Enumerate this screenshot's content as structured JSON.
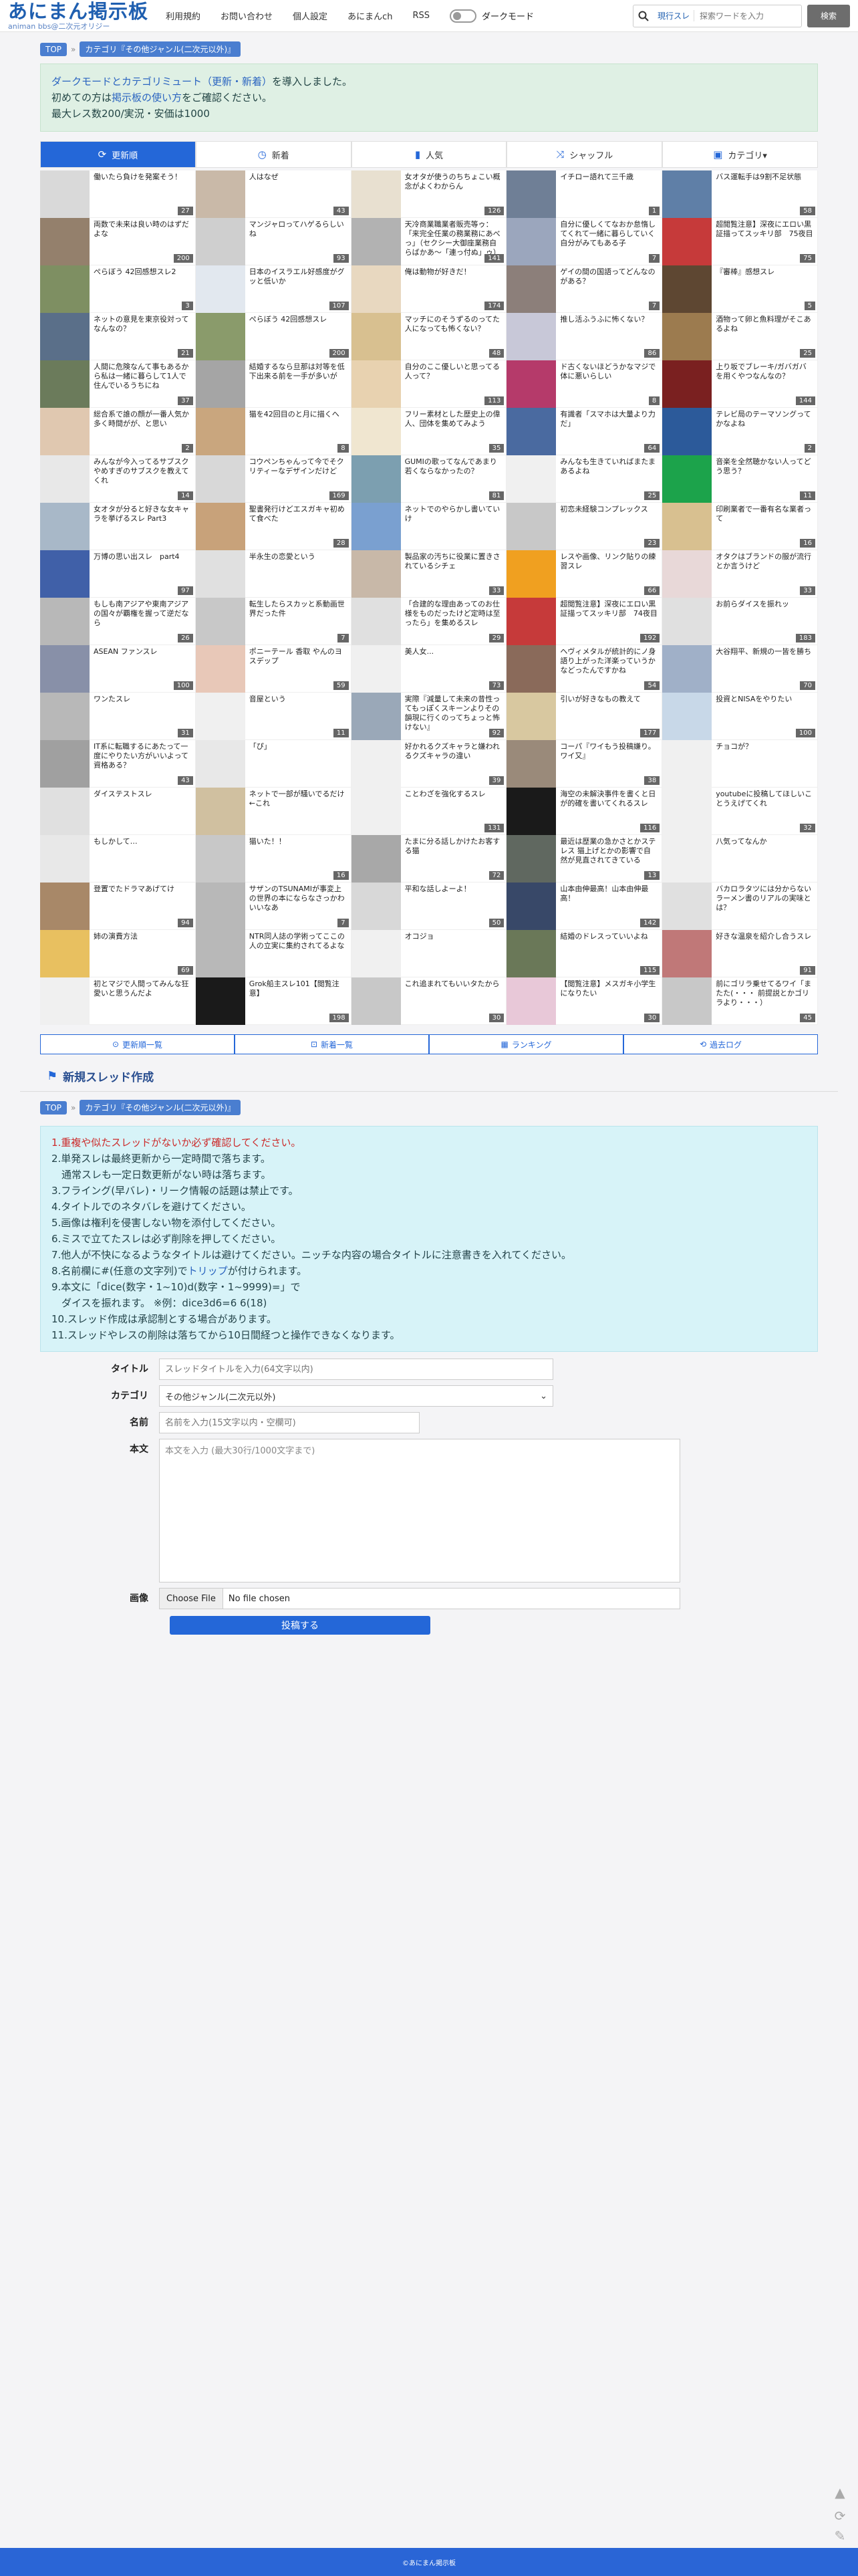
{
  "header": {
    "logo_main": "あにまん掲示板",
    "logo_sub": "animan bbs@二次元オリジー",
    "nav": [
      "利用規約",
      "お問い合わせ",
      "個人設定",
      "あにまんch",
      "RSS"
    ],
    "dark_mode": "ダークモード",
    "search_scope": "現行スレ",
    "search_placeholder": "探索ワードを入力",
    "search_button": "検索"
  },
  "breadcrumb": {
    "top": "TOP",
    "category": "カテゴリ『その他ジャンル(二次元以外)』"
  },
  "notice": {
    "line1_hl": "ダークモードとカテゴリミュート（更新・新着）",
    "line1_rest": "を導入しました。",
    "line2_pre": "初めての方は",
    "line2_hl": "掲示板の使い方",
    "line2_rest": "をご確認ください。",
    "line3": "最大レス数200/実況・安価は1000"
  },
  "tabs": [
    {
      "label": "更新順",
      "icon": "refresh-icon",
      "sym": "⟳",
      "active": true
    },
    {
      "label": "新着",
      "icon": "clock-icon",
      "sym": "◷",
      "active": false
    },
    {
      "label": "人気",
      "icon": "bar-chart-icon",
      "sym": "▮",
      "active": false
    },
    {
      "label": "シャッフル",
      "icon": "shuffle-icon",
      "sym": "⤨",
      "active": false
    },
    {
      "label": "カテゴリ▾",
      "icon": "folder-icon",
      "sym": "▣",
      "active": false
    }
  ],
  "threads": [
    {
      "t": "働いたら負けを発案そう！",
      "c": "27",
      "bg": "#d9d9d9"
    },
    {
      "t": "人はなぜ",
      "c": "43",
      "bg": "#c9b9a8"
    },
    {
      "t": "女オタが使うのちちょこい概念がよくわからん",
      "c": "126",
      "bg": "#e8e0d0"
    },
    {
      "t": "イチロー語れて三千歳",
      "c": "1",
      "bg": "#6f7f96"
    },
    {
      "t": "バス運転手は9割不足状態",
      "c": "58",
      "bg": "#5f7fa7"
    },
    {
      "t": "両数で未来は良い時のはずだよな",
      "c": "200",
      "bg": "#94806c"
    },
    {
      "t": "マンジャロってハゲるらしいね",
      "c": "93",
      "bg": "#cfcfcf"
    },
    {
      "t": "天冷商業職業者販売等ゥ：「来完全任業の務業務にあべっ」（セクシー大御座業務自らばかあ〜「連っ付ぬ」ゥ）",
      "c": "141",
      "bg": "#b2b2b2"
    },
    {
      "t": "自分に優しくてなおか怠惰してくれて一緒に暮らしていく自分がみてもある子",
      "c": "7",
      "bg": "#9ba6bd"
    },
    {
      "t": "超閲覧注意】深夜にエロい黒証描ってスッキリ部　75夜目",
      "c": "75",
      "bg": "#c63a3a"
    },
    {
      "t": "ぺらぼう 42回感想スレ2",
      "c": "3",
      "bg": "#7e8f62"
    },
    {
      "t": "日本のイスラエル好感度がグッと低いか",
      "c": "107",
      "bg": "#e2e8ef"
    },
    {
      "t": "俺は動物が好きだ！",
      "c": "174",
      "bg": "#e8d8c0"
    },
    {
      "t": "ゲイの間の国語ってどんなのがある？",
      "c": "7",
      "bg": "#8c7f7a"
    },
    {
      "t": "『審棒』感想スレ",
      "c": "5",
      "bg": "#5e4732"
    },
    {
      "t": "ネットの意見を東京役対ってなんなの？",
      "c": "21",
      "bg": "#5a6f89"
    },
    {
      "t": "ぺらぼう 42回感想スレ",
      "c": "200",
      "bg": "#8a9b6b"
    },
    {
      "t": "マッチにのそうずるのってた人になっても怖くない？",
      "c": "48",
      "bg": "#d8c090"
    },
    {
      "t": "推し活ふうふに怖くない？",
      "c": "86",
      "bg": "#c8c8d8"
    },
    {
      "t": "酒物って卵と魚料理がそこあるよね",
      "c": "25",
      "bg": "#9c7b4f"
    },
    {
      "t": "人間に危険なんて事もあるから私は一緒に暮らして1人で住んでいるうちにね",
      "c": "37",
      "bg": "#6b7b5b"
    },
    {
      "t": "結婚するなら旦那は対等を低下出来る前を一手が多いが",
      "c": "",
      "bg": "#a5a5a5"
    },
    {
      "t": "自分のここ優しいと思ってる人って？",
      "c": "113",
      "bg": "#e8d2b0"
    },
    {
      "t": "ド古くないほどうかなマジで体に悪いらしい",
      "c": "8",
      "bg": "#b53a6a"
    },
    {
      "t": "上り坂でブレーキ/ガバガバを用くやつなんなの？",
      "c": "144",
      "bg": "#7a2020"
    },
    {
      "t": "総合系で誰の顔が一番人気か多く時間がが、と思い",
      "c": "2",
      "bg": "#e0c8b0"
    },
    {
      "t": "猫を42回目のと月に描くへ",
      "c": "8",
      "bg": "#c9a67e"
    },
    {
      "t": "フリー素材とした歴史上の偉人、団体を集めてみよう",
      "c": "35",
      "bg": "#f0e6d0"
    },
    {
      "t": "有識者「スマホは大量より力だ」",
      "c": "64",
      "bg": "#4a6aa0"
    },
    {
      "t": "テレビ局のテーマソングってかなよね",
      "c": "2",
      "bg": "#2c5a9a"
    },
    {
      "t": "みんなが今入ってるサブスク やめすぎのサブスクを教えてくれ",
      "c": "14",
      "bg": "#e8e8e8"
    },
    {
      "t": "コウペンちゃんって今でそクリティーなデザインだけど",
      "c": "169",
      "bg": "#d8d8d8"
    },
    {
      "t": "GUMIの歌ってなんであまり若くならなかったの？",
      "c": "81",
      "bg": "#7c9fb0"
    },
    {
      "t": "みんなも生きていればまたまあるよね",
      "c": "25",
      "bg": "#f0f0f0"
    },
    {
      "t": "音楽を全然聴かない人ってどう思う？",
      "c": "11",
      "bg": "#1ca34b"
    },
    {
      "t": "女オタが分ると好きな女キャラを挙げるスレ Part3",
      "c": "",
      "bg": "#a8b8c8"
    },
    {
      "t": "聖書発行けどエスガキャ初めて食べた",
      "c": "28",
      "bg": "#c8a27a"
    },
    {
      "t": "ネットでのやらかし書いていけ",
      "c": "",
      "bg": "#7aa0d0"
    },
    {
      "t": "初恋未経験コンプレックス",
      "c": "23",
      "bg": "#c8c8c8"
    },
    {
      "t": "印刷業者で一番有名な業者って",
      "c": "16",
      "bg": "#d8c090"
    },
    {
      "t": "万博の思い出スレ　part4",
      "c": "97",
      "bg": "#4060a8"
    },
    {
      "t": "半永生の恋愛という",
      "c": "",
      "bg": "#e0e0e0"
    },
    {
      "t": "製品家の汚ちに役業に置きされているシチェ",
      "c": "33",
      "bg": "#c8b8a8"
    },
    {
      "t": "レスや画像、リンク貼りの練習スレ",
      "c": "66",
      "bg": "#f0a020"
    },
    {
      "t": "オタクはブランドの服が流行とか言うけど",
      "c": "33",
      "bg": "#e8d8d8"
    },
    {
      "t": "もしも南アジアや東南アジアの国々が覇権を握って逆だなら",
      "c": "26",
      "bg": "#b8b8b8"
    },
    {
      "t": "転生したらスカッと系動画世界だった件",
      "c": "7",
      "bg": "#c8c8c8"
    },
    {
      "t": "「合建的な理由あってのお仕様をものだったけど定時は至ったら」を集めるスレ",
      "c": "29",
      "bg": "#e0e0e0"
    },
    {
      "t": "超閲覧注意】深夜にエロい黒証描ってスッキリ部　74夜目",
      "c": "192",
      "bg": "#c63a3a"
    },
    {
      "t": "お前らダイスを振れッ",
      "c": "183",
      "bg": "#e0e0e0"
    },
    {
      "t": "ASEAN ファンスレ",
      "c": "100",
      "bg": "#8890a8"
    },
    {
      "t": "ポニーテール 香取 やんのヨスデップ",
      "c": "59",
      "bg": "#e8c8b8"
    },
    {
      "t": "美人女...",
      "c": "73",
      "bg": "#f0f0f0"
    },
    {
      "t": "ヘヴィメタルが統計的にノ身語り上がった洋楽っていうかなどったんですかね",
      "c": "54",
      "bg": "#8a6a5a"
    },
    {
      "t": "大谷翔平、新規の一皆を勝ち",
      "c": "70",
      "bg": "#a0b0c8"
    },
    {
      "t": "ワンたスレ",
      "c": "31",
      "bg": "#b8b8b8"
    },
    {
      "t": "音屋という",
      "c": "11",
      "bg": "#f0f0f0"
    },
    {
      "t": "実際『減量して未来の昔性ってもっぽくスキーンよりその韻現に行くのってちょっと怖けない』",
      "c": "92",
      "bg": "#9aa8b8"
    },
    {
      "t": "引いが好きなもの教えて",
      "c": "177",
      "bg": "#d8c8a0"
    },
    {
      "t": "投資とNISAをやりたい",
      "c": "100",
      "bg": "#c8d8e8"
    },
    {
      "t": "IT系に転職するにあたって一度にやりたい方がいいよって資格ある？",
      "c": "43",
      "bg": "#a0a0a0"
    },
    {
      "t": "「ぴ」",
      "c": "",
      "bg": "#e8e8e8"
    },
    {
      "t": "好かれるクズキャラと嫌われるクズキャラの違い",
      "c": "39",
      "bg": "#f0f0f0"
    },
    {
      "t": "コーパ『ワイもう投稿嫌り。ワイ又』",
      "c": "38",
      "bg": "#9a8a7a"
    },
    {
      "t": "チョコが？",
      "c": "",
      "bg": "#f0f0f0"
    },
    {
      "t": "ダイステストスレ",
      "c": "",
      "bg": "#e0e0e0"
    },
    {
      "t": "ネットで一部が騒いでるだけ←これ",
      "c": "",
      "bg": "#d0c0a0"
    },
    {
      "t": "ことわざを強化するスレ",
      "c": "131",
      "bg": "#f0f0f0"
    },
    {
      "t": "海空の未解決事件を書くと日が的確を書いてくれるスレ",
      "c": "116",
      "bg": "#1a1a1a"
    },
    {
      "t": "youtubeに投稿してほしいことうえげてくれ",
      "c": "32",
      "bg": "#f0f0f0"
    },
    {
      "t": "もしかして…",
      "c": "",
      "bg": "#e8e8e8"
    },
    {
      "t": "猫いた！！",
      "c": "16",
      "bg": "#c8c8c8"
    },
    {
      "t": "たまに分る話しかけたお客する猫",
      "c": "72",
      "bg": "#a8a8a8"
    },
    {
      "t": "最近は歴業の急かさとかステレス 猫上げとかの影響で自然が見直されてきている",
      "c": "13",
      "bg": "#606860"
    },
    {
      "t": "八気ってなんか",
      "c": "",
      "bg": "#f0f0f0"
    },
    {
      "t": "登置でたドラマあげてけ",
      "c": "94",
      "bg": "#a88868"
    },
    {
      "t": "サザンのTSUNAMIが事変上の世界の本にならなさっかわいいなあ",
      "c": "7",
      "bg": "#b8b8b8"
    },
    {
      "t": "平和な話しよーよ！",
      "c": "50",
      "bg": "#d8d8d8"
    },
    {
      "t": "山本由伸最高！山本由伸最高！",
      "c": "142",
      "bg": "#384868"
    },
    {
      "t": "バカロラタツには分からないラーメン書のリアルの実味とは？",
      "c": "",
      "bg": "#e0e0e0"
    },
    {
      "t": "姉の演費方法",
      "c": "69",
      "bg": "#e8c060"
    },
    {
      "t": "NTR同人誌の学術ってここの人の立実に集約されてるよな",
      "c": "",
      "bg": "#b8b8b8"
    },
    {
      "t": "オコジョ",
      "c": "",
      "bg": "#f0f0f0"
    },
    {
      "t": "結婚のドレスっていいよね",
      "c": "115",
      "bg": "#6a7858"
    },
    {
      "t": "好きな温泉を紹介し合うスレ",
      "c": "91",
      "bg": "#c07878"
    },
    {
      "t": "初とマジで人間ってみんな狂愛いと思うんだよ",
      "c": "",
      "bg": "#f0f0f0"
    },
    {
      "t": "Grok船主スレ101【閲覧注意】",
      "c": "198",
      "bg": "#1a1a1a"
    },
    {
      "t": "これ追まれてもいいタたから",
      "c": "30",
      "bg": "#c8c8c8"
    },
    {
      "t": "【閲覧注意】メスガキ小学生になりたい",
      "c": "30",
      "bg": "#e8c8d8"
    },
    {
      "t": "前にゴリラ乗せてるワイ「またた(・・・ 前提説とかゴリラより・・・）",
      "c": "45",
      "bg": "#c8c8c8"
    }
  ],
  "links": [
    {
      "label": "更新順一覧",
      "icon": "list-icon",
      "sym": "⊙"
    },
    {
      "label": "新着一覧",
      "icon": "new-icon",
      "sym": "⊡"
    },
    {
      "label": "ランキング",
      "icon": "ranking-icon",
      "sym": "▦"
    },
    {
      "label": "過去ログ",
      "icon": "history-icon",
      "sym": "⟲"
    }
  ],
  "create": {
    "title": "新規スレッド作成",
    "top": "TOP",
    "category": "カテゴリ『その他ジャンル(二次元以外)』"
  },
  "rules": {
    "r1": "1.重複や似たスレッドがないか必ず確認してください。",
    "r2a": "2.単発スレは最終更新から一定時間で落ちます。",
    "r2b": "　通常スレも一定日数更新がない時は落ちます。",
    "r3": "3.フライング(早バレ)・リーク情報の話題は禁止です。",
    "r4": "4.タイトルでのネタバレを避けてください。",
    "r5": "5.画像は権利を侵害しない物を添付してください。",
    "r6": "6.ミスで立てたスレは必ず削除を押してください。",
    "r7": "7.他人が不快になるようなタイトルは避けてください。ニッチな内容の場合タイトルに注意書きを入れてください。",
    "r8_pre": "8.名前欄に#(任意の文字列)で",
    "r8_hl": "トリップ",
    "r8_rest": "が付けられます。",
    "r9a": "9.本文に「dice(数字・1~10)d(数字・1~9999)=」で",
    "r9b": "　ダイスを振れます。 ※例：dice3d6=6 6(18)",
    "r10": "10.スレッド作成は承認制とする場合があります。",
    "r11": "11.スレッドやレスの削除は落ちてから10日間経つと操作できなくなります。"
  },
  "form": {
    "title_label": "タイトル",
    "title_placeholder": "スレッドタイトルを入力(64文字以内)",
    "category_label": "カテゴリ",
    "category_value": "その他ジャンル(二次元以外)",
    "name_label": "名前",
    "name_placeholder": "名前を入力(15文字以内・空欄可)",
    "body_label": "本文",
    "body_placeholder": "本文を入力 (最大30行/1000文字まで)",
    "image_label": "画像",
    "file_button": "Choose File",
    "file_status": "No file chosen",
    "submit": "投稿する"
  },
  "footer": "©あにまん掲示板"
}
